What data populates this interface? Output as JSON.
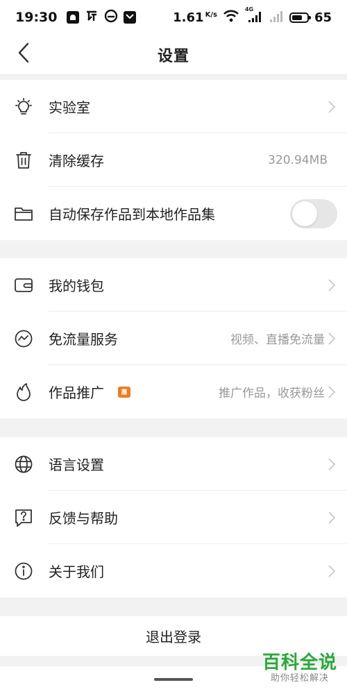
{
  "status_bar": {
    "time": "19:30",
    "speed": "1.61",
    "speed_unit": "K/s",
    "network": "4G",
    "battery": "65"
  },
  "header": {
    "title": "设置"
  },
  "groups": [
    {
      "items": [
        {
          "icon": "bulb-icon",
          "label": "实验室",
          "value": "",
          "chevron": true
        },
        {
          "icon": "trash-icon",
          "label": "清除缓存",
          "value": "320.94MB",
          "chevron": false
        },
        {
          "icon": "folder-icon",
          "label": "自动保存作品到本地作品集",
          "value": "",
          "chevron": false,
          "toggle": false
        }
      ]
    },
    {
      "items": [
        {
          "icon": "wallet-icon",
          "label": "我的钱包",
          "value": "",
          "chevron": true
        },
        {
          "icon": "data-free-icon",
          "label": "免流量服务",
          "value": "视频、直播免流量",
          "chevron": true
        },
        {
          "icon": "flame-icon",
          "label": "作品推广",
          "badge": "惠",
          "value": "推广作品，收获粉丝",
          "chevron": true
        }
      ]
    },
    {
      "items": [
        {
          "icon": "globe-icon",
          "label": "语言设置",
          "value": "",
          "chevron": true
        },
        {
          "icon": "feedback-icon",
          "label": "反馈与帮助",
          "value": "",
          "chevron": true
        },
        {
          "icon": "info-icon",
          "label": "关于我们",
          "value": "",
          "chevron": true
        }
      ]
    }
  ],
  "logout": {
    "label": "退出登录"
  },
  "watermark": {
    "main": "百科全说",
    "sub": "助你轻松解决"
  },
  "colors": {
    "toggle_off": "#e6e6e6",
    "badge": "#f07a1d",
    "watermark": "#29a93a"
  }
}
